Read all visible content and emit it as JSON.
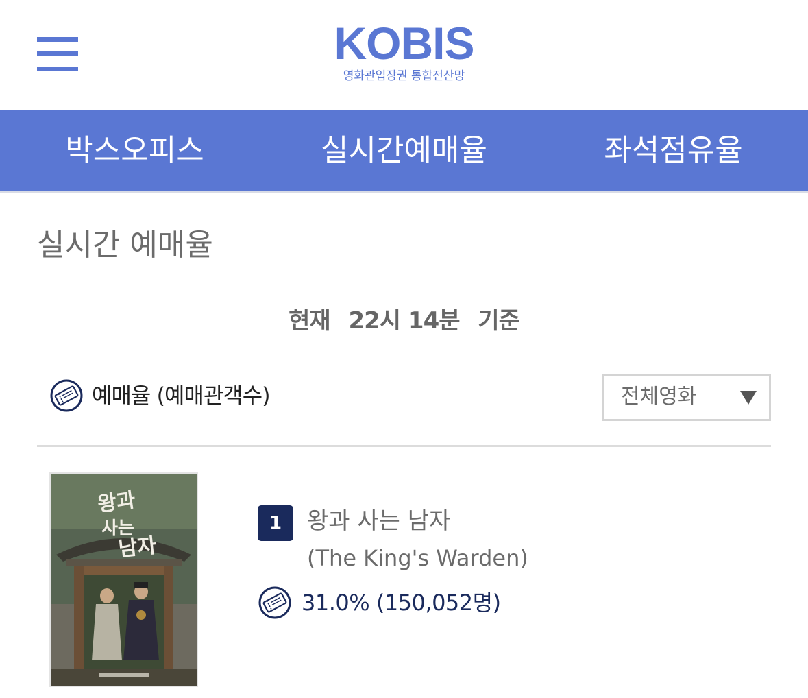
{
  "header": {
    "menu_icon": "hamburger-menu-icon",
    "logo_title": "KOBIS",
    "logo_subtitle": "영화관입장권 통합전산망",
    "brand_color": "#5a77d3"
  },
  "nav": {
    "items": [
      {
        "label": "박스오피스"
      },
      {
        "label": "실시간예매율"
      },
      {
        "label": "좌석점유율"
      }
    ]
  },
  "page": {
    "title": "실시간 예매율",
    "time": {
      "prefix": "현재",
      "value": "22시 14분",
      "suffix": "기준"
    }
  },
  "filter": {
    "label_icon": "ticket-icon",
    "label": "예매율 (예매관객수)",
    "select_value": "전체영화",
    "select_arrow_icon": "dropdown-arrow-icon"
  },
  "movies": [
    {
      "rank": "1",
      "title": "왕과 사는 남자",
      "title_en": "(The King's Warden)",
      "rate_icon": "ticket-icon",
      "rate_text": "31.0% (150,052명)",
      "poster_title": "왕과 사는 남자",
      "accent_color": "#1a2a5c"
    }
  ]
}
